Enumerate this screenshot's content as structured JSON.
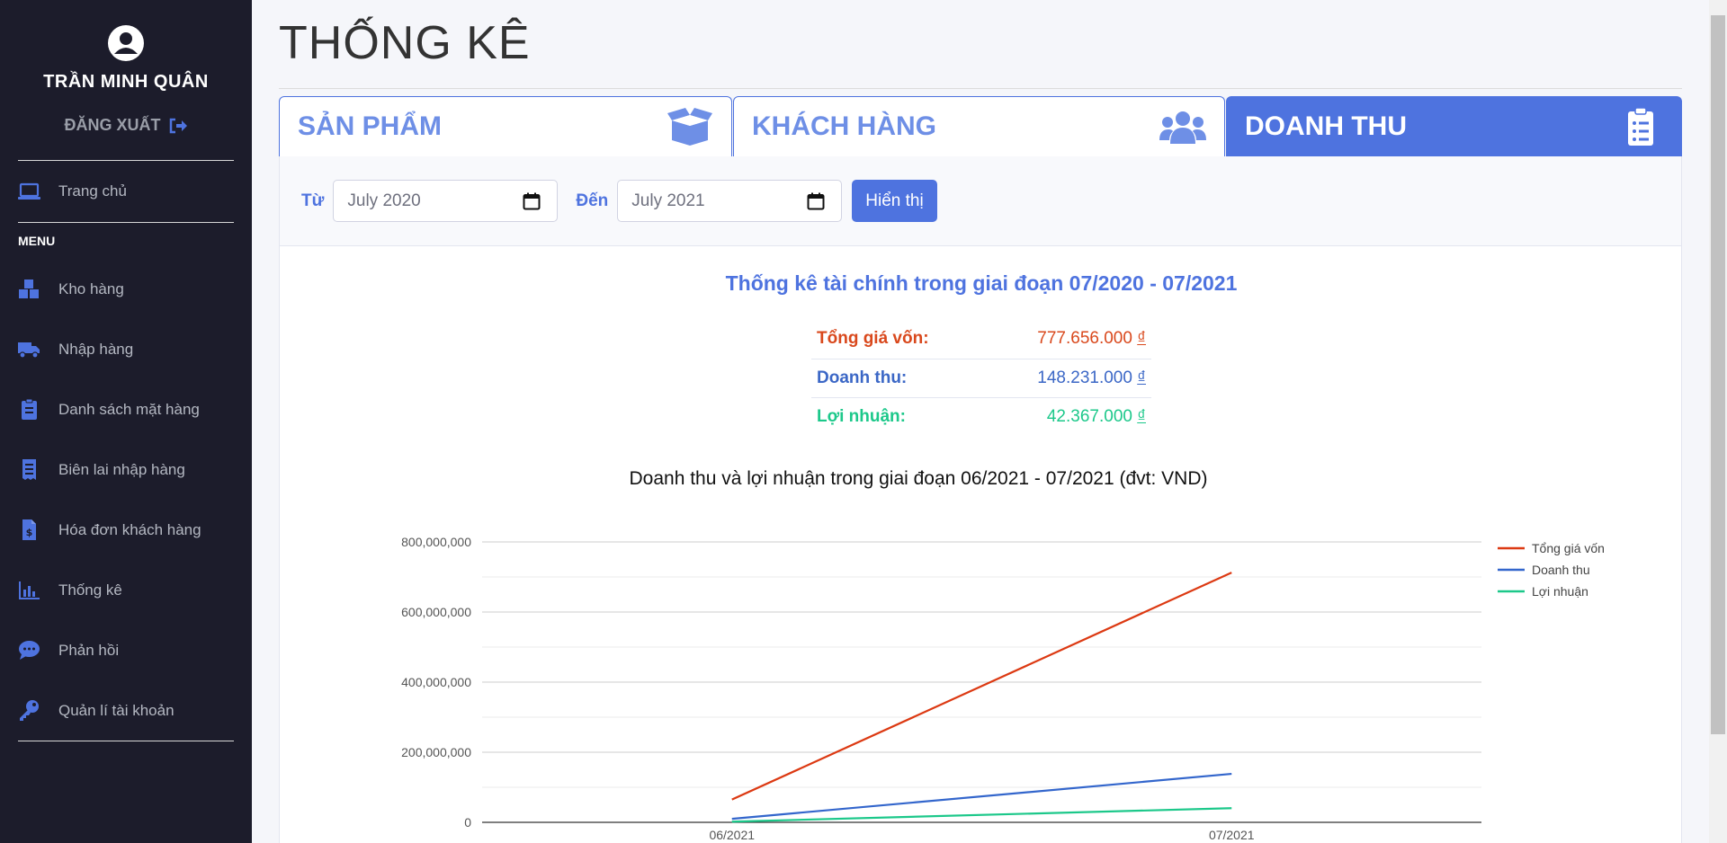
{
  "sidebar": {
    "user_name": "TRẦN MINH QUÂN",
    "logout_label": "ĐĂNG XUẤT",
    "home_label": "Trang chủ",
    "menu_heading": "MENU",
    "items": [
      {
        "label": "Kho hàng",
        "icon": "warehouse-icon"
      },
      {
        "label": "Nhập hàng",
        "icon": "truck-icon"
      },
      {
        "label": "Danh sách mặt hàng",
        "icon": "clipboard-icon"
      },
      {
        "label": "Biên lai nhập hàng",
        "icon": "receipt-icon"
      },
      {
        "label": "Hóa đơn khách hàng",
        "icon": "invoice-dollar-icon"
      },
      {
        "label": "Thống kê",
        "icon": "bar-chart-icon"
      },
      {
        "label": "Phản hồi",
        "icon": "chat-icon"
      },
      {
        "label": "Quản lí tài khoản",
        "icon": "key-icon"
      }
    ]
  },
  "page": {
    "title": "THỐNG KÊ"
  },
  "tabs": [
    {
      "label": "SẢN PHẨM",
      "icon": "box-open-icon",
      "active": false
    },
    {
      "label": "KHÁCH HÀNG",
      "icon": "users-icon",
      "active": false
    },
    {
      "label": "DOANH THU",
      "icon": "clipboard-list-icon",
      "active": true
    }
  ],
  "filter": {
    "from_label": "Từ",
    "from_value": "July 2020",
    "to_label": "Đến",
    "to_value": "July 2021",
    "show_button": "Hiển thị"
  },
  "summary": {
    "title": "Thống kê tài chính trong giai đoạn 07/2020 - 07/2021",
    "currency": "₫",
    "rows": [
      {
        "label": "Tổng giá vốn:",
        "value": "777.656.000",
        "color": "#d9481c"
      },
      {
        "label": "Doanh thu:",
        "value": "148.231.000",
        "color": "#3b67c6"
      },
      {
        "label": "Lợi nhuận:",
        "value": "42.367.000",
        "color": "#1cc88a"
      }
    ]
  },
  "colors": {
    "accent": "#4e73df",
    "sidebar_bg": "#1c1c2b"
  },
  "chart_data": {
    "type": "line",
    "title": "Doanh thu và lợi nhuận trong giai đoạn 06/2021 - 07/2021 (đvt: VND)",
    "categories": [
      "06/2021",
      "07/2021"
    ],
    "y_ticks": [
      "0",
      "200,000,000",
      "400,000,000",
      "600,000,000",
      "800,000,000"
    ],
    "ylim": [
      0,
      800000000
    ],
    "grid": true,
    "legend_position": "right",
    "series": [
      {
        "name": "Tổng giá vốn",
        "values": [
          65000000,
          712656000
        ],
        "color": "#dc3912"
      },
      {
        "name": "Doanh thu",
        "values": [
          10000000,
          138231000
        ],
        "color": "#3366cc"
      },
      {
        "name": "Lợi nhuận",
        "values": [
          2000000,
          40367000
        ],
        "color": "#1cc88a"
      }
    ]
  }
}
